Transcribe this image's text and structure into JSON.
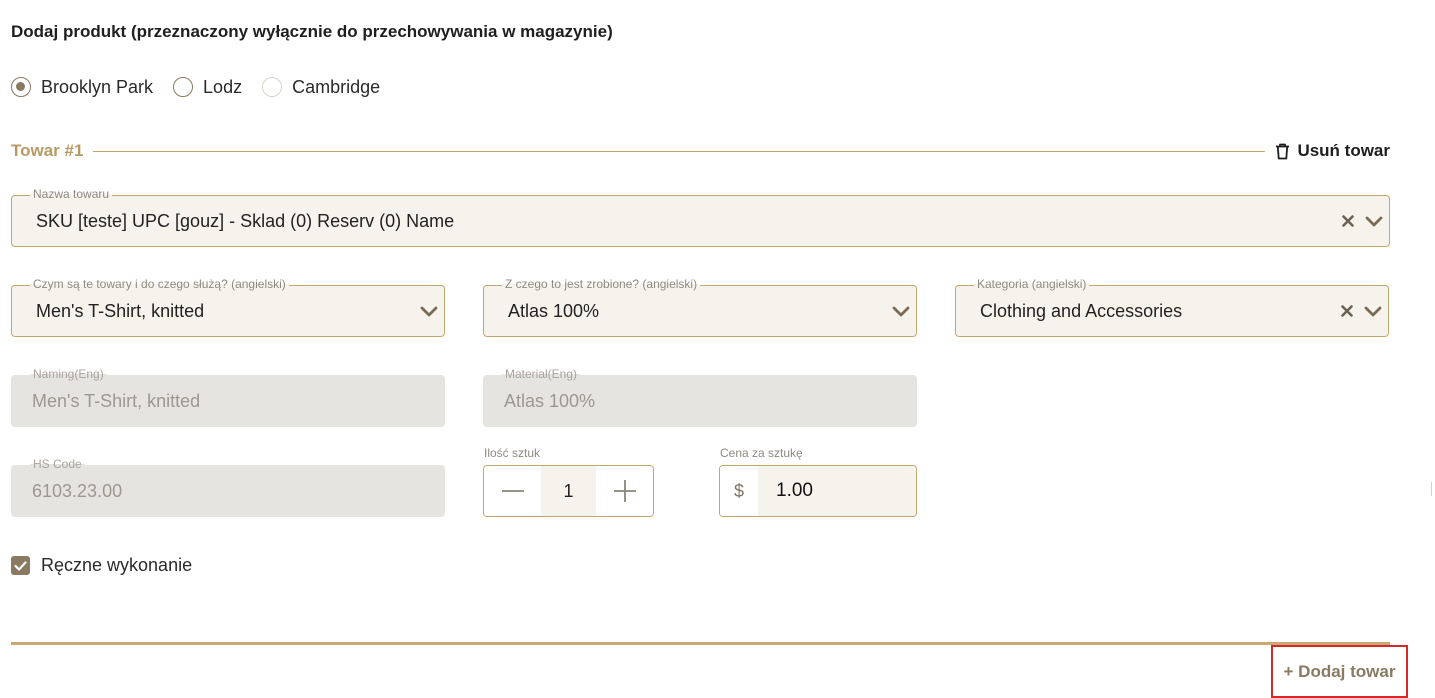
{
  "form": {
    "title": "Dodaj produkt (przeznaczony wyłącznie do przechowywania w magazynie)",
    "warehouses": [
      {
        "label": "Brooklyn Park",
        "checked": true
      },
      {
        "label": "Lodz",
        "checked": false
      },
      {
        "label": "Cambridge",
        "checked": false
      }
    ]
  },
  "item": {
    "title": "Towar #1",
    "remove_label": "Usuń towar",
    "name_field": {
      "label": "Nazwa towaru",
      "value": "SKU [teste] UPC [gouz] - Sklad (0) Reserv (0) Name"
    },
    "what_field": {
      "label": "Czym są te towary i do czego służą? (angielski)",
      "value": "Men's T-Shirt, knitted"
    },
    "material_field": {
      "label": "Z czego to jest zrobione? (angielski)",
      "value": "Atlas 100%"
    },
    "category_field": {
      "label": "Kategoria (angielski)",
      "value": "Clothing and Accessories"
    },
    "naming_eng": {
      "label": "Naming(Eng)",
      "value": "Men's T-Shirt, knitted"
    },
    "material_eng": {
      "label": "Material(Eng)",
      "value": "Atlas 100%"
    },
    "hs_code": {
      "label": "HS Code",
      "value": "6103.23.00"
    },
    "quantity": {
      "label": "Ilość sztuk",
      "value": "1"
    },
    "price": {
      "label": "Cena za sztukę",
      "currency": "$",
      "value": "1.00"
    },
    "handmade": {
      "label": "Ręczne wykonanie",
      "checked": true
    }
  },
  "actions": {
    "add_item_label": "+ Dodaj towar"
  },
  "colors": {
    "accent": "#c4a772",
    "accent_dark": "#8a7a62",
    "field_bg": "#f6f3ec",
    "disabled_bg": "#e6e4e0",
    "highlight": "#d62828"
  },
  "icons": {
    "remove": "trash-icon",
    "clear": "close-icon",
    "dropdown": "chevron-down-icon",
    "minus": "minus-icon",
    "plus": "plus-icon",
    "check": "check-icon"
  }
}
